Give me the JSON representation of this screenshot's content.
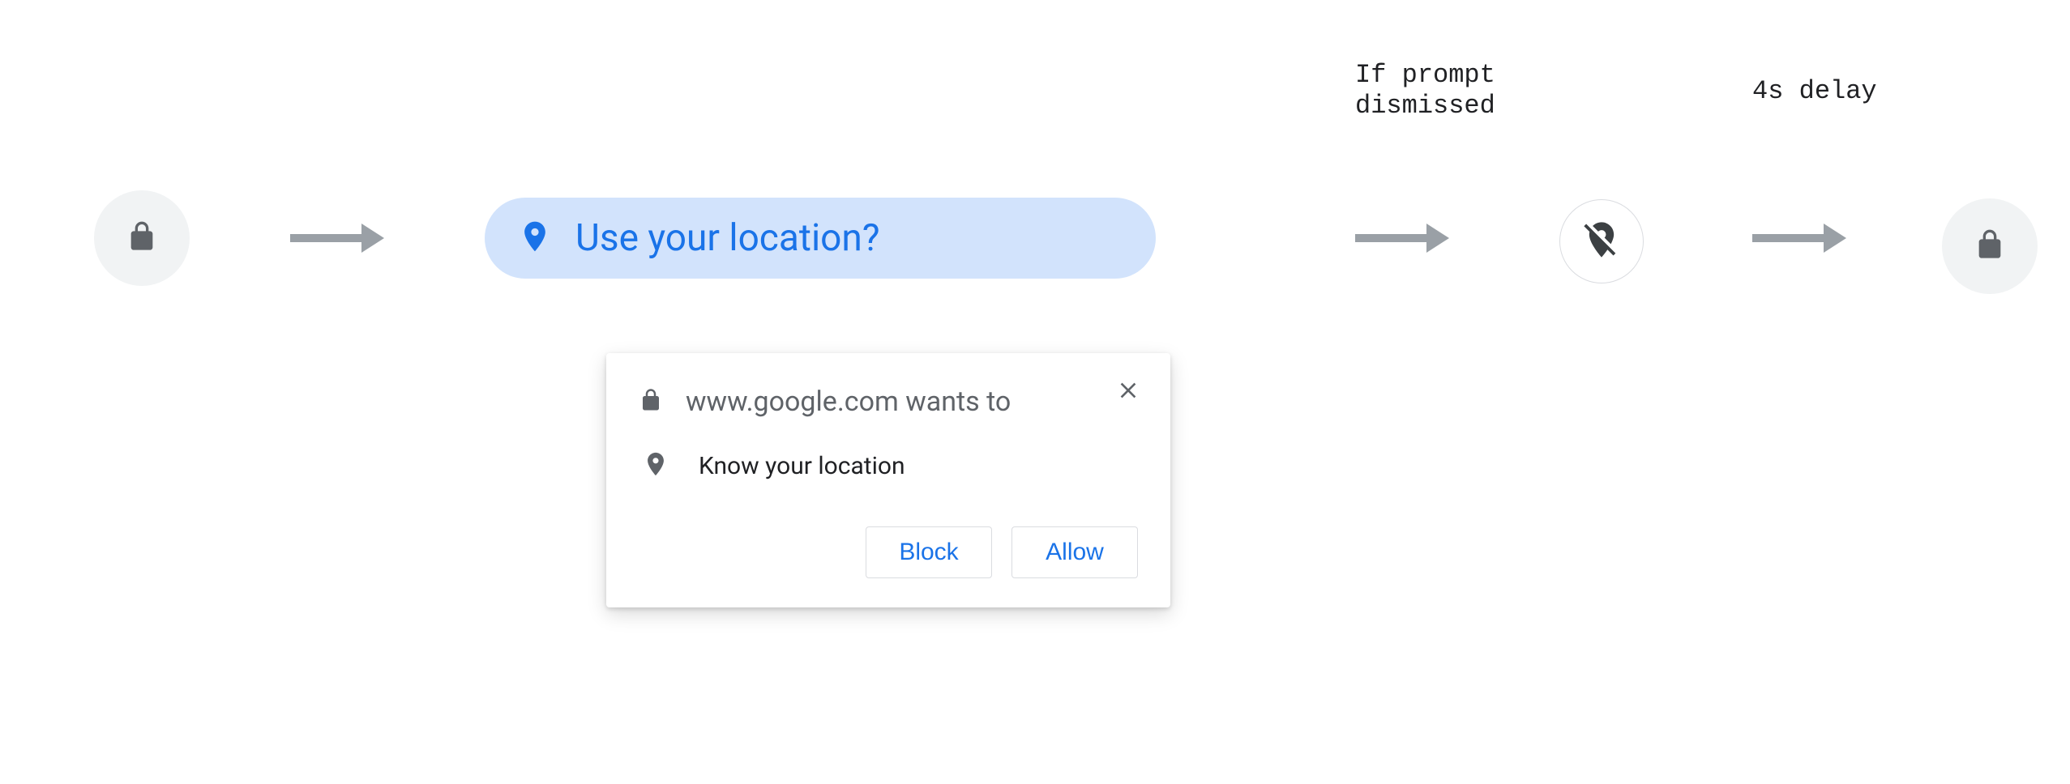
{
  "annotations": {
    "dismissed": "If prompt\ndismissed",
    "delay": "4s delay"
  },
  "chip": {
    "label": "Use your location?"
  },
  "dialog": {
    "title_site": "www.google.com wants to",
    "permission_label": "Know your location",
    "block_label": "Block",
    "allow_label": "Allow"
  }
}
